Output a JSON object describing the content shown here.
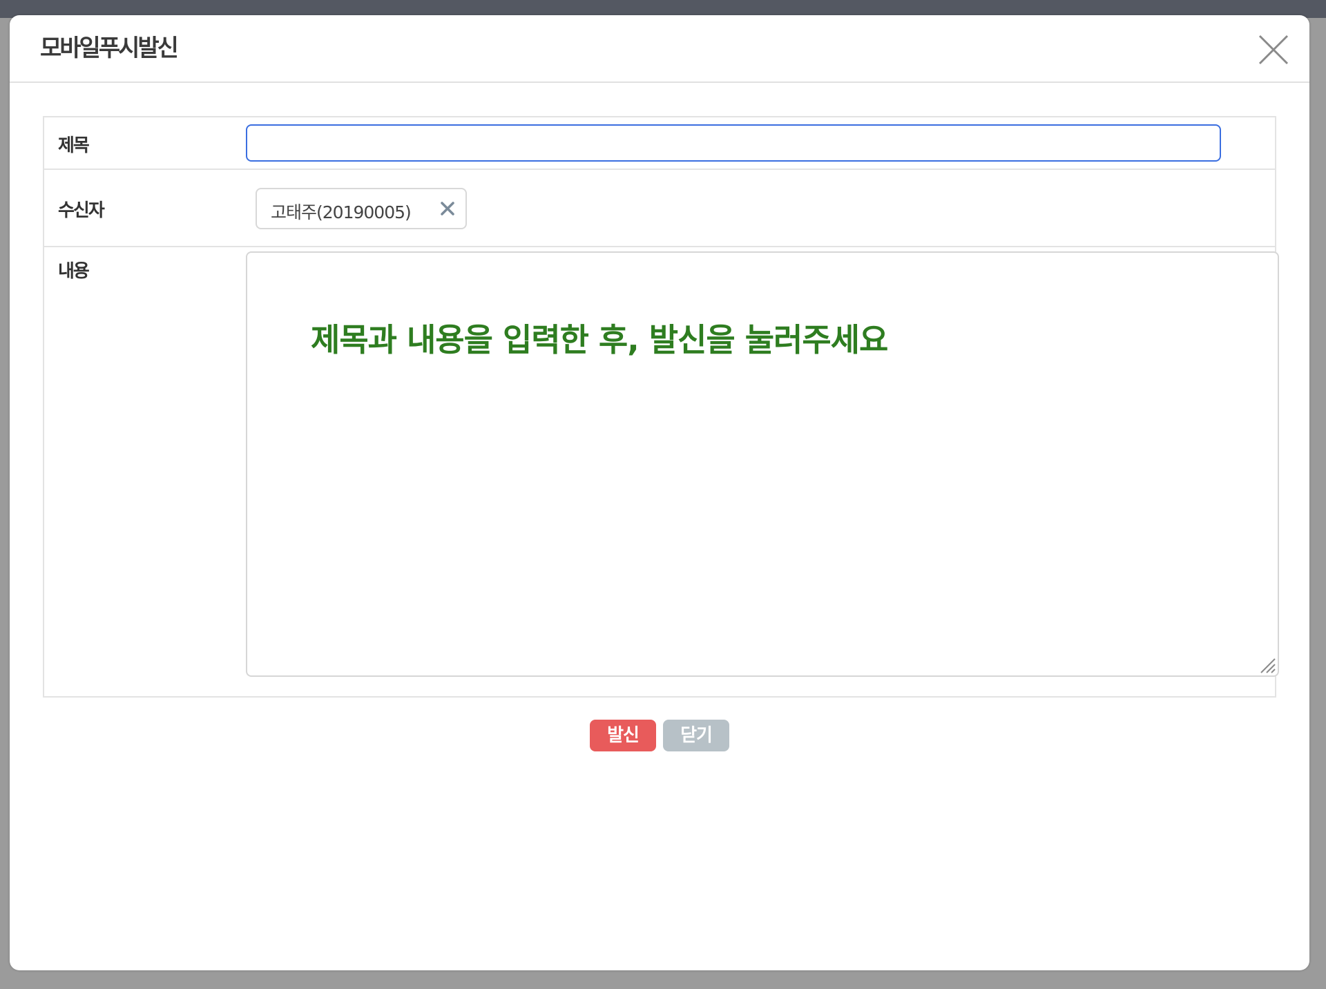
{
  "dialog": {
    "title": "모바일푸시발신",
    "close_icon": "close-icon"
  },
  "form": {
    "title_label": "제목",
    "title_value": "",
    "recipient_label": "수신자",
    "recipients": [
      {
        "name": "고태주(20190005)",
        "remove_icon": "remove-icon"
      }
    ],
    "content_label": "내용",
    "content_placeholder": "제목과 내용을 입력한 후, 발신을 눌러주세요"
  },
  "actions": {
    "send_label": "발신",
    "close_label": "닫기"
  },
  "colors": {
    "accent_input_border": "#3a6ee0",
    "send_button": "#e85b5b",
    "close_button": "#b7c1c7",
    "placeholder_text": "#2e7d20"
  }
}
